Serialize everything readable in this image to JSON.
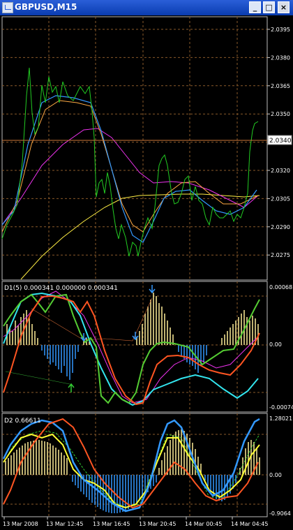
{
  "window": {
    "title": "GBPUSD,M15",
    "buttons": {
      "minimize": "_",
      "maximize": "□",
      "close": "×"
    }
  },
  "main_chart": {
    "price_labels": [
      "2.0395",
      "2.0380",
      "2.0365",
      "2.0350",
      "2.0335",
      "2.0320",
      "2.0305",
      "2.0290",
      "2.0275"
    ],
    "current_price": "2.0340",
    "colors": {
      "price": "#22cc22",
      "ma_fast": "#3399ff",
      "ma_mid": "#ffaa44",
      "ma_slow_magenta": "#ee33ee",
      "ma_slowest": "#ffee44",
      "grid": "#8a5a2a"
    }
  },
  "d1_panel": {
    "label": "D1(5) 0.000341 0.000000 0.000341",
    "scale": {
      "top": "0.00068",
      "zero": "0.00",
      "bottom": "-0.00074"
    }
  },
  "d2_panel": {
    "label": "D2 0.66611",
    "scale": {
      "top": "1.28021",
      "zero": "0.00",
      "bottom": "-0.9064"
    }
  },
  "time_axis": [
    "13 Mar 2008",
    "13 Mar 12:45",
    "13 Mar 16:45",
    "13 Mar 20:45",
    "14 Mar 00:45",
    "14 Mar 04:45"
  ]
}
